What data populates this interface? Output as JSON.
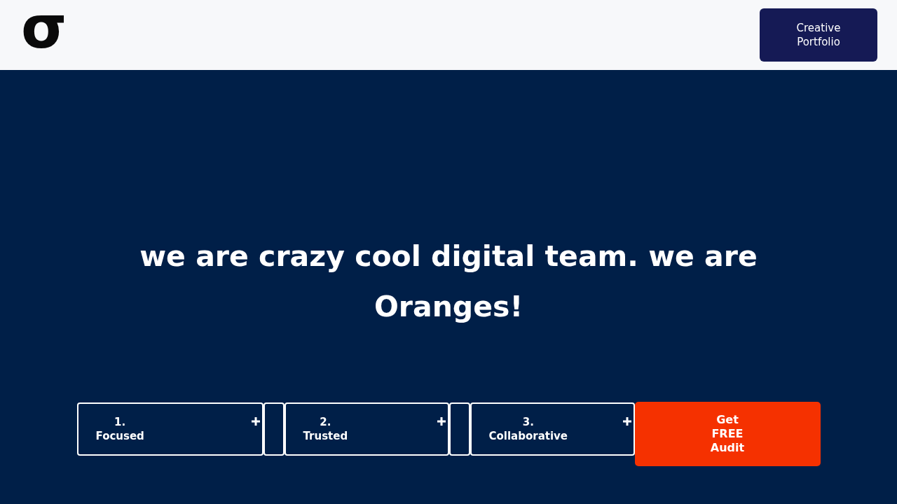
{
  "header": {
    "logo": "σ",
    "button": "Creative Portfolio"
  },
  "hero": {
    "headline": "we are crazy cool digital team. we are Oranges!"
  },
  "features": [
    {
      "number": "1.",
      "label": "Focused"
    },
    {
      "number": "2.",
      "label": "Trusted"
    },
    {
      "number": "3.",
      "label": "Collaborative"
    }
  ],
  "cta": "Get FREE Audit"
}
